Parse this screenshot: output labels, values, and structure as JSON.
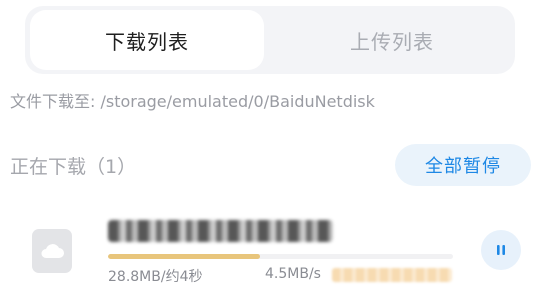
{
  "tabs": {
    "download_label": "下载列表",
    "upload_label": "上传列表"
  },
  "path": {
    "text": "文件下载至: /storage/emulated/0/BaiduNetdisk"
  },
  "section": {
    "title": "正在下载（1）",
    "pause_all_label": "全部暂停"
  },
  "download_item": {
    "icon": "cloud-icon",
    "progress_fraction": 0.44,
    "size_time": "28.8MB/约4秒",
    "speed": "4.5MB/s"
  },
  "colors": {
    "accent": "#1e88e5",
    "progress": "#e8c57b"
  }
}
